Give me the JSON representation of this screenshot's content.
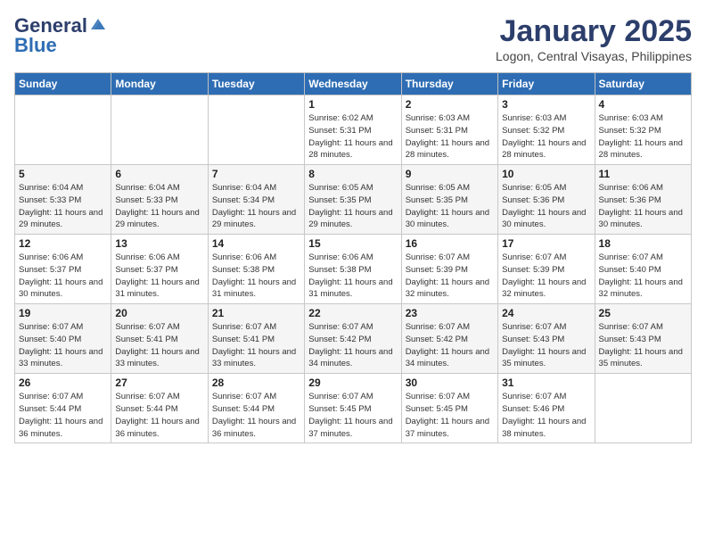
{
  "logo": {
    "general": "General",
    "blue": "Blue"
  },
  "header": {
    "month": "January 2025",
    "location": "Logon, Central Visayas, Philippines"
  },
  "weekdays": [
    "Sunday",
    "Monday",
    "Tuesday",
    "Wednesday",
    "Thursday",
    "Friday",
    "Saturday"
  ],
  "weeks": [
    [
      {
        "day": "",
        "sunrise": "",
        "sunset": "",
        "daylight": ""
      },
      {
        "day": "",
        "sunrise": "",
        "sunset": "",
        "daylight": ""
      },
      {
        "day": "",
        "sunrise": "",
        "sunset": "",
        "daylight": ""
      },
      {
        "day": "1",
        "sunrise": "Sunrise: 6:02 AM",
        "sunset": "Sunset: 5:31 PM",
        "daylight": "Daylight: 11 hours and 28 minutes."
      },
      {
        "day": "2",
        "sunrise": "Sunrise: 6:03 AM",
        "sunset": "Sunset: 5:31 PM",
        "daylight": "Daylight: 11 hours and 28 minutes."
      },
      {
        "day": "3",
        "sunrise": "Sunrise: 6:03 AM",
        "sunset": "Sunset: 5:32 PM",
        "daylight": "Daylight: 11 hours and 28 minutes."
      },
      {
        "day": "4",
        "sunrise": "Sunrise: 6:03 AM",
        "sunset": "Sunset: 5:32 PM",
        "daylight": "Daylight: 11 hours and 28 minutes."
      }
    ],
    [
      {
        "day": "5",
        "sunrise": "Sunrise: 6:04 AM",
        "sunset": "Sunset: 5:33 PM",
        "daylight": "Daylight: 11 hours and 29 minutes."
      },
      {
        "day": "6",
        "sunrise": "Sunrise: 6:04 AM",
        "sunset": "Sunset: 5:33 PM",
        "daylight": "Daylight: 11 hours and 29 minutes."
      },
      {
        "day": "7",
        "sunrise": "Sunrise: 6:04 AM",
        "sunset": "Sunset: 5:34 PM",
        "daylight": "Daylight: 11 hours and 29 minutes."
      },
      {
        "day": "8",
        "sunrise": "Sunrise: 6:05 AM",
        "sunset": "Sunset: 5:35 PM",
        "daylight": "Daylight: 11 hours and 29 minutes."
      },
      {
        "day": "9",
        "sunrise": "Sunrise: 6:05 AM",
        "sunset": "Sunset: 5:35 PM",
        "daylight": "Daylight: 11 hours and 30 minutes."
      },
      {
        "day": "10",
        "sunrise": "Sunrise: 6:05 AM",
        "sunset": "Sunset: 5:36 PM",
        "daylight": "Daylight: 11 hours and 30 minutes."
      },
      {
        "day": "11",
        "sunrise": "Sunrise: 6:06 AM",
        "sunset": "Sunset: 5:36 PM",
        "daylight": "Daylight: 11 hours and 30 minutes."
      }
    ],
    [
      {
        "day": "12",
        "sunrise": "Sunrise: 6:06 AM",
        "sunset": "Sunset: 5:37 PM",
        "daylight": "Daylight: 11 hours and 30 minutes."
      },
      {
        "day": "13",
        "sunrise": "Sunrise: 6:06 AM",
        "sunset": "Sunset: 5:37 PM",
        "daylight": "Daylight: 11 hours and 31 minutes."
      },
      {
        "day": "14",
        "sunrise": "Sunrise: 6:06 AM",
        "sunset": "Sunset: 5:38 PM",
        "daylight": "Daylight: 11 hours and 31 minutes."
      },
      {
        "day": "15",
        "sunrise": "Sunrise: 6:06 AM",
        "sunset": "Sunset: 5:38 PM",
        "daylight": "Daylight: 11 hours and 31 minutes."
      },
      {
        "day": "16",
        "sunrise": "Sunrise: 6:07 AM",
        "sunset": "Sunset: 5:39 PM",
        "daylight": "Daylight: 11 hours and 32 minutes."
      },
      {
        "day": "17",
        "sunrise": "Sunrise: 6:07 AM",
        "sunset": "Sunset: 5:39 PM",
        "daylight": "Daylight: 11 hours and 32 minutes."
      },
      {
        "day": "18",
        "sunrise": "Sunrise: 6:07 AM",
        "sunset": "Sunset: 5:40 PM",
        "daylight": "Daylight: 11 hours and 32 minutes."
      }
    ],
    [
      {
        "day": "19",
        "sunrise": "Sunrise: 6:07 AM",
        "sunset": "Sunset: 5:40 PM",
        "daylight": "Daylight: 11 hours and 33 minutes."
      },
      {
        "day": "20",
        "sunrise": "Sunrise: 6:07 AM",
        "sunset": "Sunset: 5:41 PM",
        "daylight": "Daylight: 11 hours and 33 minutes."
      },
      {
        "day": "21",
        "sunrise": "Sunrise: 6:07 AM",
        "sunset": "Sunset: 5:41 PM",
        "daylight": "Daylight: 11 hours and 33 minutes."
      },
      {
        "day": "22",
        "sunrise": "Sunrise: 6:07 AM",
        "sunset": "Sunset: 5:42 PM",
        "daylight": "Daylight: 11 hours and 34 minutes."
      },
      {
        "day": "23",
        "sunrise": "Sunrise: 6:07 AM",
        "sunset": "Sunset: 5:42 PM",
        "daylight": "Daylight: 11 hours and 34 minutes."
      },
      {
        "day": "24",
        "sunrise": "Sunrise: 6:07 AM",
        "sunset": "Sunset: 5:43 PM",
        "daylight": "Daylight: 11 hours and 35 minutes."
      },
      {
        "day": "25",
        "sunrise": "Sunrise: 6:07 AM",
        "sunset": "Sunset: 5:43 PM",
        "daylight": "Daylight: 11 hours and 35 minutes."
      }
    ],
    [
      {
        "day": "26",
        "sunrise": "Sunrise: 6:07 AM",
        "sunset": "Sunset: 5:44 PM",
        "daylight": "Daylight: 11 hours and 36 minutes."
      },
      {
        "day": "27",
        "sunrise": "Sunrise: 6:07 AM",
        "sunset": "Sunset: 5:44 PM",
        "daylight": "Daylight: 11 hours and 36 minutes."
      },
      {
        "day": "28",
        "sunrise": "Sunrise: 6:07 AM",
        "sunset": "Sunset: 5:44 PM",
        "daylight": "Daylight: 11 hours and 36 minutes."
      },
      {
        "day": "29",
        "sunrise": "Sunrise: 6:07 AM",
        "sunset": "Sunset: 5:45 PM",
        "daylight": "Daylight: 11 hours and 37 minutes."
      },
      {
        "day": "30",
        "sunrise": "Sunrise: 6:07 AM",
        "sunset": "Sunset: 5:45 PM",
        "daylight": "Daylight: 11 hours and 37 minutes."
      },
      {
        "day": "31",
        "sunrise": "Sunrise: 6:07 AM",
        "sunset": "Sunset: 5:46 PM",
        "daylight": "Daylight: 11 hours and 38 minutes."
      },
      {
        "day": "",
        "sunrise": "",
        "sunset": "",
        "daylight": ""
      }
    ]
  ]
}
